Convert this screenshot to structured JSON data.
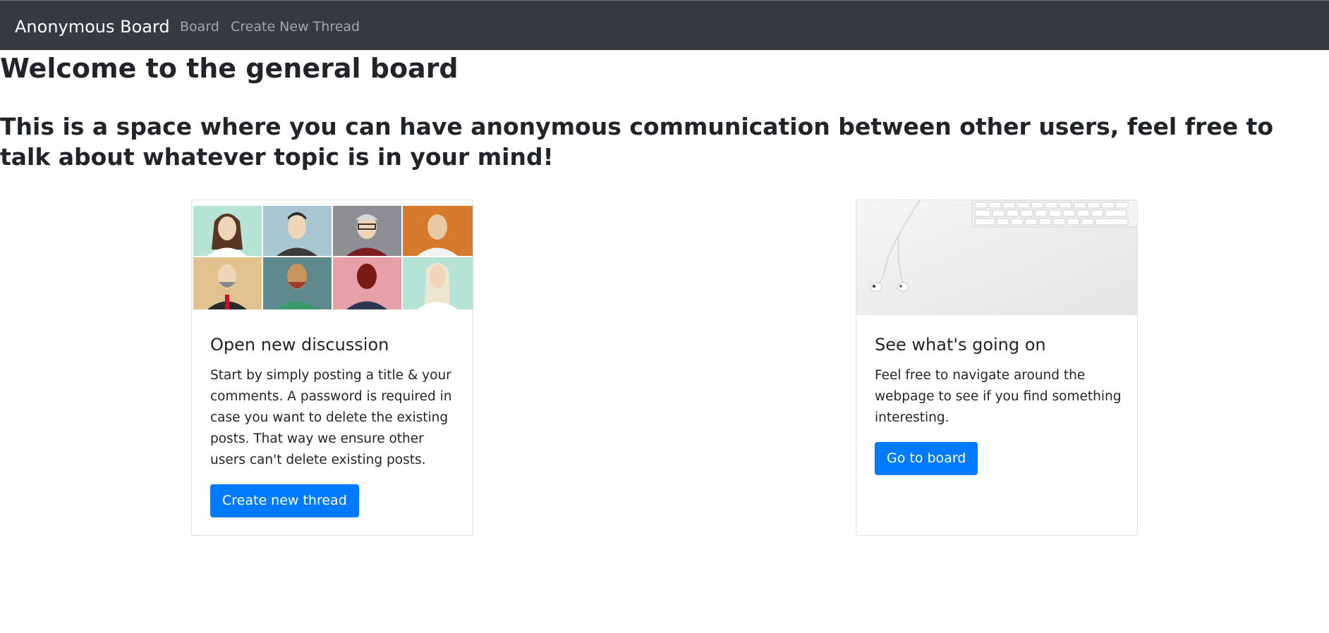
{
  "navbar": {
    "brand": "Anonymous Board",
    "links": [
      "Board",
      "Create New Thread"
    ]
  },
  "main": {
    "title": "Welcome to the general board",
    "intro": "This is a space where you can have anonymous communication between other users, feel free to talk about whatever topic is in your mind!"
  },
  "cards": [
    {
      "image": "avatars-grid-image",
      "title": "Open new discussion",
      "text": "Start by simply posting a title & your comments. A password is required in case you want to delete the existing posts. That way we ensure other users can't delete existing posts.",
      "button": "Create new thread"
    },
    {
      "image": "desk-keyboard-earphones-image",
      "title": "See what's going on",
      "text": "Feel free to navigate around the webpage to see if you find something interesting.",
      "button": "Go to board"
    }
  ],
  "colors": {
    "navbar": "#343a40",
    "primary": "#007bff",
    "text": "#212529"
  }
}
